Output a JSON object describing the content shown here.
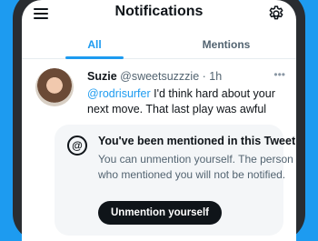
{
  "header": {
    "title": "Notifications",
    "menu_icon": "hamburger-menu-icon",
    "settings_icon": "gear-icon"
  },
  "tabs": [
    {
      "label": "All",
      "active": true
    },
    {
      "label": "Mentions",
      "active": false
    }
  ],
  "tweet": {
    "name": "Suzie",
    "handle": "@sweetsuzzzie",
    "separator": " · ",
    "time": "1h",
    "mention": "@rodrisurfer",
    "text": " I'd think hard about your next move. That last play was awful",
    "more_icon": "ellipsis-icon"
  },
  "card": {
    "icon": "at-sign-icon",
    "title": "You've been mentioned in this Tweet",
    "text": "You can unmention yourself. The person who mentioned you will not be notified.",
    "button_label": "Unmention yourself"
  },
  "colors": {
    "accent": "#1d9bf0",
    "text_primary": "#0f1419",
    "text_secondary": "#536471",
    "card_bg": "#f4f6f8"
  }
}
